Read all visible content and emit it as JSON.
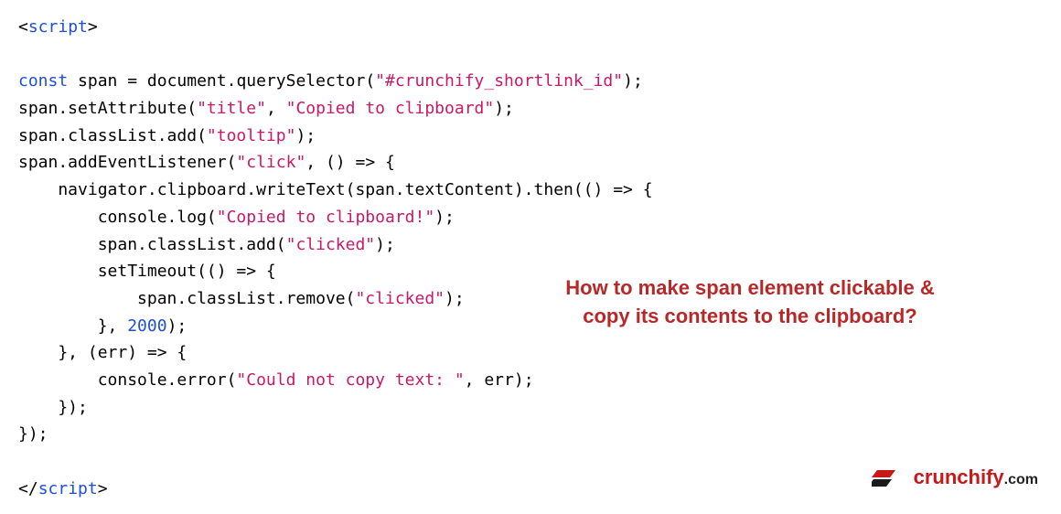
{
  "code": {
    "open_tag_bracket_open": "<",
    "open_tag_name": "script",
    "open_tag_bracket_close": ">",
    "kw_const": "const",
    "var_span": "span",
    "eq": " = ",
    "document": "document",
    "querySelector": ".querySelector(",
    "lit_selector": "\"#crunchify_shortlink_id\"",
    "close_paren_semi": ");",
    "setattr_call": "span.setAttribute(",
    "lit_title": "\"title\"",
    "comma": ", ",
    "lit_copied_to_clipboard": "\"Copied to clipboard\"",
    "classlist_add": "span.classList.add(",
    "lit_tooltip": "\"tooltip\"",
    "addEventListener": "span.addEventListener(",
    "lit_click": "\"click\"",
    "arrow_open": "() => {",
    "navigator_writeText": "    navigator.clipboard.writeText(span.textContent).then(() => {",
    "console_log": "        console.log(",
    "lit_copied_bang": "\"Copied to clipboard!\"",
    "classlist_add2": "        span.classList.add(",
    "lit_clicked": "\"clicked\"",
    "setTimeout": "        setTimeout(() => {",
    "classlist_remove": "            span.classList.remove(",
    "close_brace_comma": "        }, ",
    "num_2000": "2000",
    "close_paren_semi2": ");",
    "err_handler": "    }, (err) => {",
    "console_error": "        console.error(",
    "lit_could_not_copy": "\"Could not copy text: \"",
    "err_arg": ", err);",
    "close_brace_paren_semi": "    });",
    "close_brace_paren_semi2": "});",
    "close_tag_bracket_open": "</",
    "close_tag_name": "script",
    "close_tag_bracket_close": ">"
  },
  "callout": {
    "line1": "How to make span element clickable &",
    "line2": "copy its contents to the clipboard?"
  },
  "logo": {
    "brand": "crunchify",
    "suffix": ".com"
  }
}
